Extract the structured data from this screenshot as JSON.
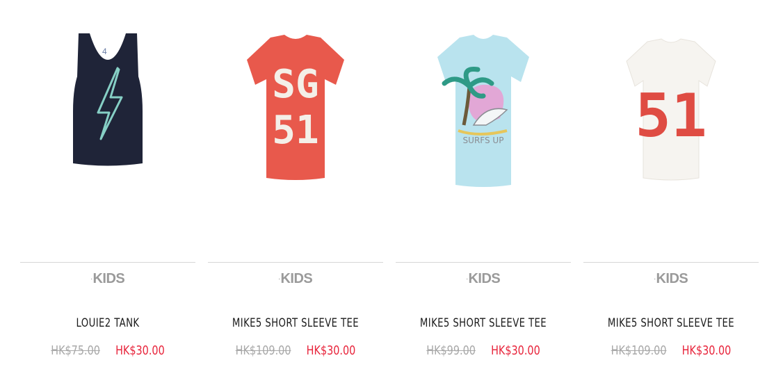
{
  "products": [
    {
      "brand": "KIDS",
      "name": "LOUIE2 TANK",
      "old_price": "HK$75.00",
      "sale_price": "HK$30.00",
      "image": {
        "icon": "navy-tank-top-lightning",
        "garment_color": "#1f2438",
        "print_color": "#86cfc5"
      }
    },
    {
      "brand": "KIDS",
      "name": "MIKE5 SHORT SLEEVE TEE",
      "old_price": "HK$109.00",
      "sale_price": "HK$30.00",
      "image": {
        "icon": "red-tee-sg51",
        "garment_color": "#e8594c",
        "print_color": "#f4efe8",
        "print_text": [
          "SG",
          "51"
        ]
      }
    },
    {
      "brand": "KIDS",
      "name": "MIKE5 SHORT SLEEVE TEE",
      "old_price": "HK$99.00",
      "sale_price": "HK$30.00",
      "image": {
        "icon": "blue-tee-palm-wave",
        "garment_color": "#b9e3ee",
        "print_color": "#e2a7d6"
      }
    },
    {
      "brand": "KIDS",
      "name": "MIKE5 SHORT SLEEVE TEE",
      "old_price": "HK$109.00",
      "sale_price": "HK$30.00",
      "image": {
        "icon": "white-tee-51",
        "garment_color": "#f6f4f0",
        "print_color": "#df4c43",
        "print_text": [
          "51"
        ]
      }
    }
  ],
  "colors": {
    "sale_price": "#e8253c",
    "old_price": "#a8a8a8",
    "title": "#1a1a1a",
    "brand": "#9a9a9a",
    "divider": "#d6d6d6"
  }
}
